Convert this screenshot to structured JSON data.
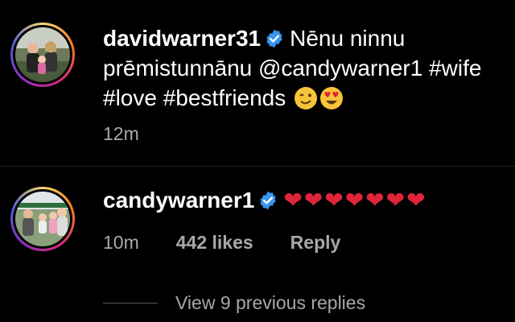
{
  "comment1": {
    "username": "davidwarner31",
    "text": "Nēnu ninnu prēmistunnānu @candywarner1 #wife #love #bestfriends",
    "emoji_names": [
      "winking-face-emoji",
      "heart-eyes-emoji"
    ],
    "time": "12m"
  },
  "comment2": {
    "username": "candywarner1",
    "hearts": "❤❤❤❤❤❤❤",
    "time": "10m",
    "likes": "442 likes",
    "reply": "Reply",
    "view_replies": "View 9 previous replies"
  },
  "colors": {
    "background": "#000000",
    "text": "#ffffff",
    "muted": "#a8a8a8",
    "verified": "#3897f0",
    "heart": "#e0243a"
  },
  "icons": [
    "verified-badge-icon"
  ]
}
